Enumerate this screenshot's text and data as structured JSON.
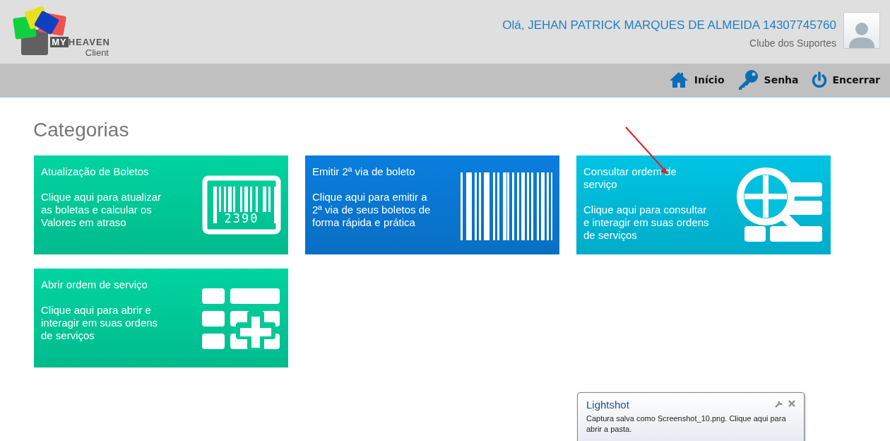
{
  "logo": {
    "brand_left": "MY",
    "brand_right": "HEAVEN",
    "subtitle": "Client"
  },
  "user": {
    "greeting": "Olá, JEHAN PATRICK MARQUES DE ALMEIDA 14307745760",
    "group": "Clube dos Suportes"
  },
  "nav": [
    {
      "kind": "home",
      "label": "Início"
    },
    {
      "kind": "key",
      "label": "Senha"
    },
    {
      "kind": "power",
      "label": "Encerrar"
    }
  ],
  "heading": "Categorias",
  "cards": [
    {
      "kind": "barcode-frame",
      "title": "Atualização de Boletos",
      "description": "Clique aqui para atualizar as boletas e calcular os Valores em atraso",
      "icon_text": "2390",
      "color": "#00d4a0"
    },
    {
      "kind": "barcode",
      "title": "Emitir 2ª via de boleto",
      "description": "Clique aqui para emitir a 2ª via de seus boletos de forma rápida e prática",
      "color": "#0a7ede"
    },
    {
      "kind": "search-grid",
      "title": "Consultar ordem de serviço",
      "description": "Clique aqui para consultar e interagir em suas ordens de serviços",
      "color": "#00c4e4"
    },
    {
      "kind": "grid-plus",
      "title": "Abrir ordem de serviço",
      "description": "Clique aqui para abrir e interagir em suas ordens de serviços",
      "color": "#00d4a0"
    }
  ],
  "notification": {
    "title": "Lightshot",
    "message": "Captura salva como Screenshot_10.png. Clique aqui para abrir a pasta."
  }
}
